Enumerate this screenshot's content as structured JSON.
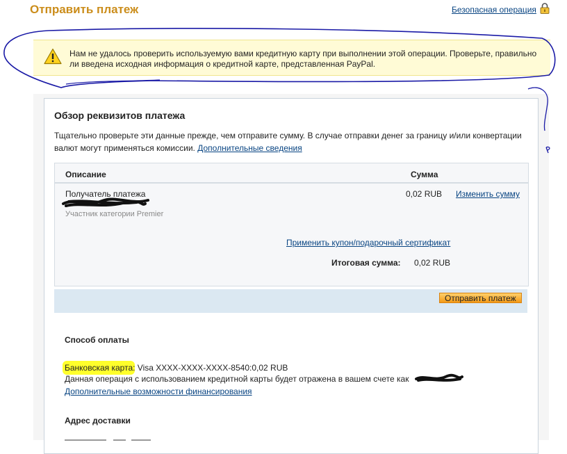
{
  "header": {
    "title": "Отправить платеж",
    "secure_link": "Безопасная операция",
    "lock_icon": "lock-icon"
  },
  "alert": {
    "icon": "warning-icon",
    "message": "Нам не удалось проверить используемую вами кредитную карту при выполнении этой операции. Проверьте, правильно ли введена исходная информация о кредитной карте, представленная PayPal."
  },
  "review": {
    "title": "Обзор реквизитов платежа",
    "description": "Тщательно проверьте эти данные прежде, чем отправите сумму. В случае отправки денег за границу и/или конвертации валют могут применяться комиссии.",
    "more_info_link": "Дополнительные сведения"
  },
  "summary": {
    "columns": {
      "description": "Описание",
      "amount": "Сумма"
    },
    "recipient_label": "Получатель платежа",
    "member_type": "Участник категории Premier",
    "amount": "0,02 RUB",
    "change_amount_link": "Изменить сумму",
    "coupon_link": "Применить купон/подарочный сертификат",
    "total_label": "Итоговая сумма:",
    "total_value": "0,02 RUB"
  },
  "actions": {
    "send_button": "Отправить платеж"
  },
  "payment": {
    "heading": "Способ оплаты",
    "card_type": "Банковская карта",
    "card_details": ": Visa XXXX-XXXX-XXXX-8540:0,02 RUB",
    "note": "Данная операция с использованием кредитной карты будет отражена в вашем счете как",
    "funding_link": "Дополнительные возможности финансирования"
  },
  "shipping": {
    "heading": "Адрес доставки"
  },
  "colors": {
    "title_orange": "#cb8d1b",
    "link_blue": "#084482",
    "alert_bg": "#fffbd6",
    "highlight_yellow": "#ffff2b",
    "action_bar": "#dbe8f2",
    "scribble_blue": "#1a1aa6"
  }
}
